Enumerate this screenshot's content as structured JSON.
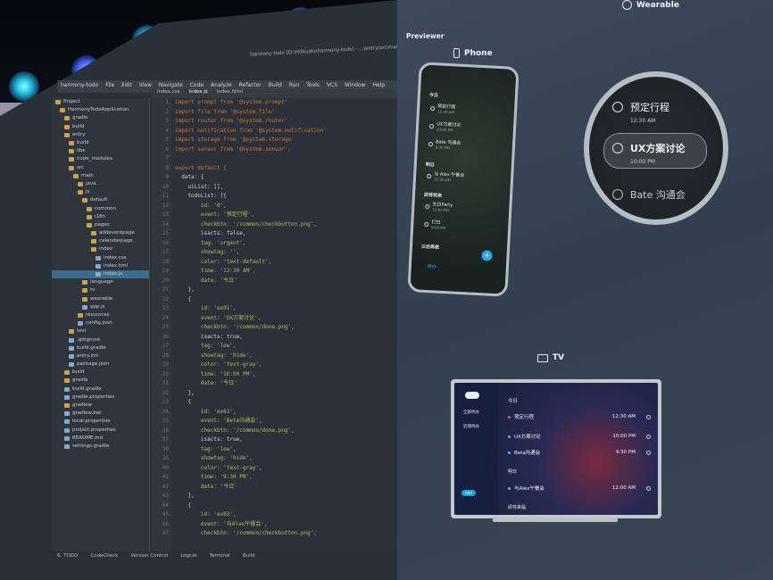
{
  "toolbar": {
    "project_label": "harmony-todo",
    "menus": [
      "File",
      "Edit",
      "View",
      "Navigate",
      "Code",
      "Analyze",
      "Refactor",
      "Build",
      "Run",
      "Tools",
      "VCS",
      "Window",
      "Help"
    ],
    "path_text": "harmony-todo [D:\\HiStudio\\harmony-todo] - ...\\entry\\src\\main\\js\\default\\pages\\index\\index.js"
  },
  "tabs": [
    "index.css",
    "index.js",
    "index.html"
  ],
  "project_tree": [
    "Project",
    "HarmonyTodoApplication",
    "gradle",
    "build",
    "entry",
    "build",
    "libs",
    "node_modules",
    "src",
    "main",
    "java",
    "js",
    "default",
    "common",
    "i18n",
    "pages",
    "addeventpage",
    "calendarpage",
    "index",
    "index.css",
    "index.hml",
    "index.js",
    "language",
    "tv",
    "wearable",
    "app.js",
    "resources",
    "config.json",
    "test",
    ".gitignore",
    "build.gradle",
    "entry.iml",
    "package.json",
    "build",
    "gradle",
    "build.gradle",
    "gradle.properties",
    "gradlew",
    "gradlew.bat",
    "local.properties",
    "project.properties",
    "README.md",
    "settings.gradle"
  ],
  "code_lines": [
    "import prompt from '@system.prompt'",
    "import file from '@system.file'",
    "import router from '@system.router'",
    "import notification from '@system.notification'",
    "import storage from '@system.storage'",
    "import sensor from '@system.sensor';",
    "",
    "export default {",
    "  data: {",
    "    uiList: [],",
    "    todoList: [{",
    "        id: '0',",
    "        event: '预定行程',",
    "        checkbtn: '/common/checkbutton.png',",
    "        isacts: false,",
    "        tag: 'urgent',",
    "        showtag: '',",
    "        color: 'text-default',",
    "        time: '12:30 AM',",
    "        date: '今日'",
    "    },",
    "    {",
    "        id: 'ex01',",
    "        event: 'UX方案讨论',",
    "        checkbtn: '/common/done.png',",
    "        isacts: true,",
    "        tag: 'low',",
    "        showtag: 'hide',",
    "        color: 'text-gray',",
    "        time: '10:00 PM',",
    "        date: '今日'",
    "    },",
    "    {",
    "        id: 'ex02',",
    "        event: 'Beta沟通会',",
    "        checkbtn: '/common/done.png',",
    "        isacts: true,",
    "        tag: 'low',",
    "        showtag: 'hide',",
    "        color: 'text-gray',",
    "        time: '9:30 PM',",
    "        date: '今日'",
    "    },",
    "    {",
    "        id: 'ex03',",
    "        event: '与Alex午餐会',",
    "        checkbtn: '/common/checkbutton.png',"
  ],
  "statusbar": [
    "6: TODO",
    "CodeCheck",
    "Version Control",
    "Logcat",
    "Terminal",
    "Build"
  ],
  "previewer": {
    "title": "Previewer",
    "phone_label": "Phone",
    "wearable_label": "Wearable",
    "tv_label": "TV"
  },
  "phone": {
    "today": "今日",
    "items": [
      {
        "event": "预定行程",
        "time": "12:30 AM"
      },
      {
        "event": "UX方案讨论",
        "time": "10:00 PM"
      },
      {
        "event": "Bate 沟通会",
        "time": "9:30 PM"
      }
    ],
    "tomorrow": "明日",
    "item_tomorrow": {
      "event": "与 Alex 午餐会",
      "time": "12:00 AM"
    },
    "later": "即将到来",
    "later_items": [
      {
        "event": "生日Party",
        "time": "10:00 PM"
      },
      {
        "event": "打扫",
        "time": "9:00 PM"
      }
    ],
    "done": "以后再做",
    "bottom_label": "待办"
  },
  "watch": {
    "items": [
      {
        "event": "预定行程",
        "time": "12:30 AM"
      },
      {
        "event": "UX方案讨论",
        "time": "10:00 PM"
      },
      {
        "event": "Bate 沟通会",
        "time": ""
      }
    ]
  },
  "tv": {
    "side_items": [
      "全部待办",
      "近期待办"
    ],
    "side_button": "Add",
    "today": "今日",
    "rows": [
      {
        "event": "预定行程",
        "time": "12:30 AM"
      },
      {
        "event": "UX方案讨论",
        "time": "10:00 PM"
      },
      {
        "event": "Beta沟通会",
        "time": "9:30 PM"
      }
    ],
    "tomorrow": "明日",
    "row_tomorrow": {
      "event": "与Alex午餐会",
      "time": "12:00 AM"
    },
    "later": "即将来临"
  }
}
